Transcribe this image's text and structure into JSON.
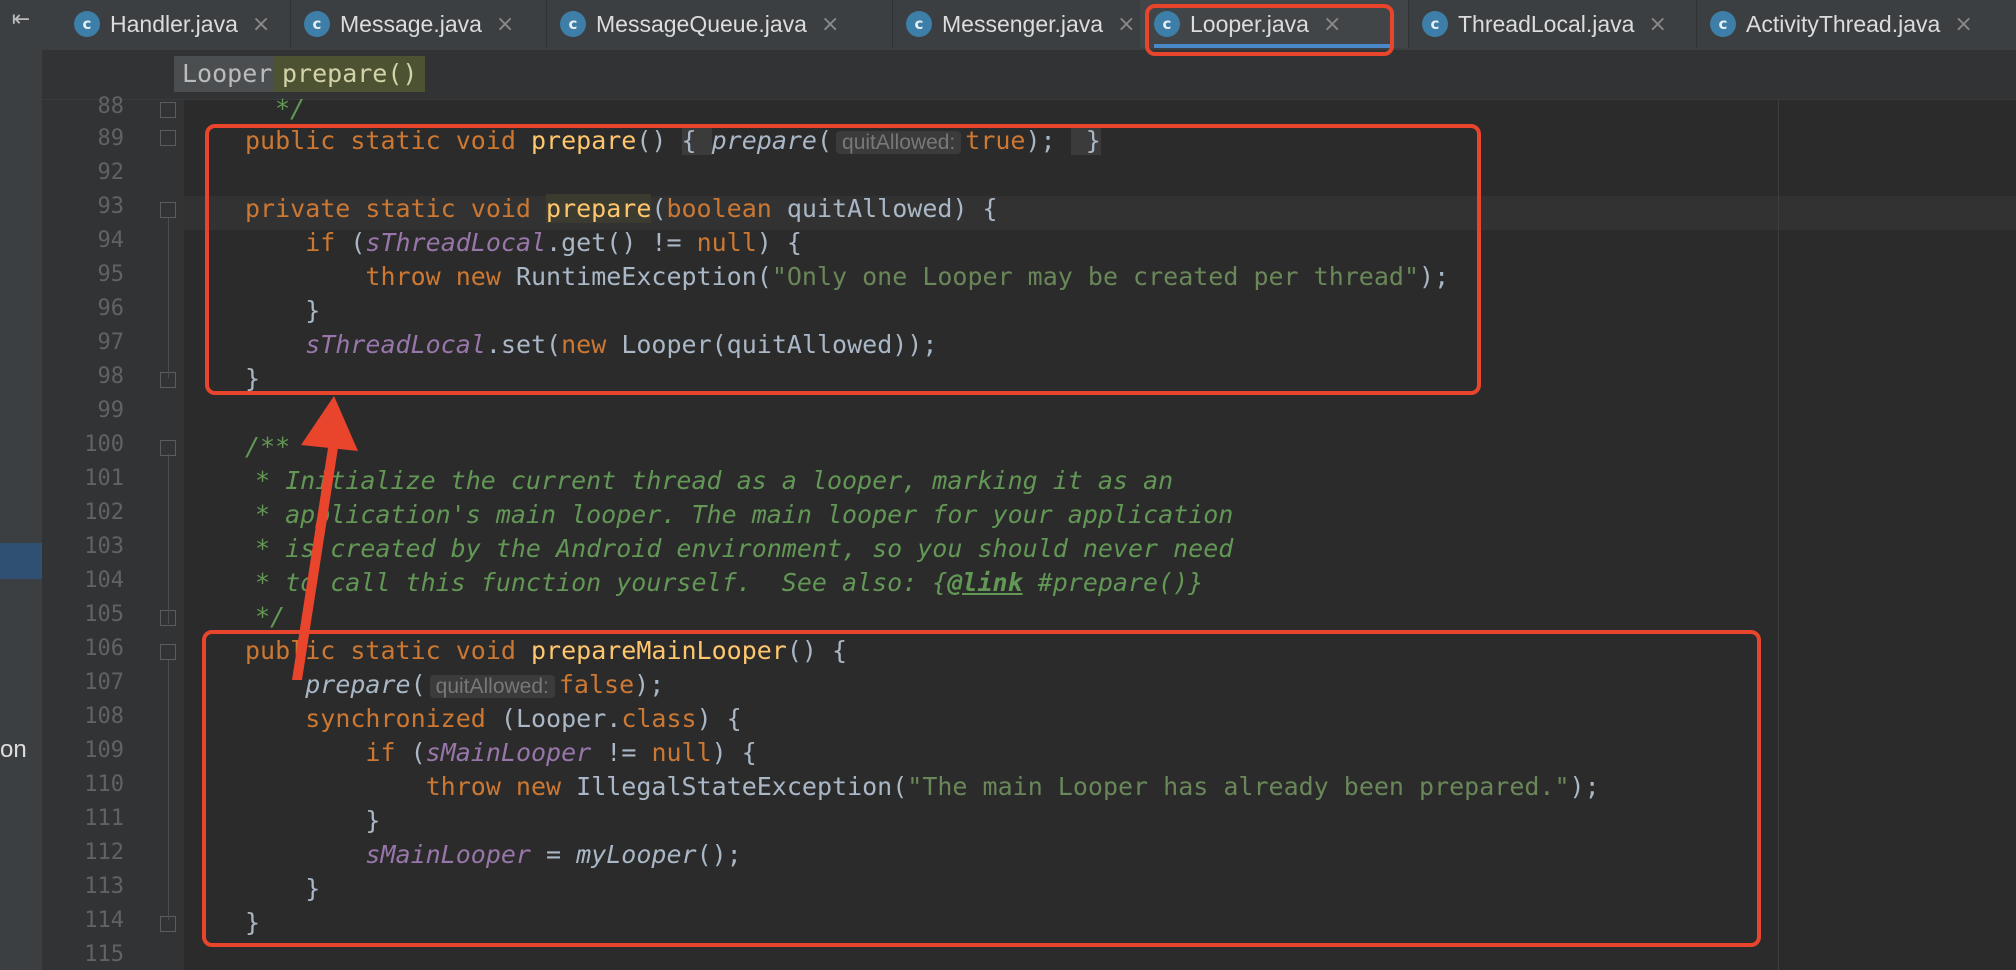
{
  "tabs": [
    {
      "label": "Handler.java",
      "icon": "c-class-icon"
    },
    {
      "label": "Message.java",
      "icon": "c-class-icon"
    },
    {
      "label": "MessageQueue.java",
      "icon": "c-class-icon"
    },
    {
      "label": "Messenger.java",
      "icon": "c-class-icon"
    },
    {
      "label": "Looper.java",
      "icon": "c-class-icon",
      "active": true
    },
    {
      "label": "ThreadLocal.java",
      "icon": "c-class-icon"
    },
    {
      "label": "ActivityThread.java",
      "icon": "c-class-icon"
    }
  ],
  "breadcrumb": [
    "Looper",
    "prepare()"
  ],
  "sidebar": {
    "partial_label": "on"
  },
  "line_numbers": [
    "88",
    "89",
    "92",
    "93",
    "94",
    "95",
    "96",
    "97",
    "98",
    "99",
    "100",
    "101",
    "102",
    "103",
    "104",
    "105",
    "106",
    "107",
    "108",
    "109",
    "110",
    "111",
    "112",
    "113",
    "114",
    "115"
  ],
  "code": {
    "l88": "*/",
    "hint_quit": "quitAllowed:",
    "s_only_one": "\"Only one Looper may be created per thread\"",
    "s_main_looper": "\"The main Looper has already been prepared.\"",
    "doc101": "* Initialize the current thread as a looper, marking it as an",
    "doc102": "* application's main looper. The main looper for your application",
    "doc103": "* is created by the Android environment, so you should never need",
    "doc104a": "* to call this function yourself.  See also: {",
    "doc104b": "@link",
    "doc104c": " #prepare()}"
  },
  "colors": {
    "keyword": "#cc7832",
    "function": "#ffc66d",
    "static_field": "#9876aa",
    "string": "#6a8759",
    "comment": "#629755",
    "annotation": "#e8452c",
    "active_tab_underline": "#4a88c7"
  }
}
